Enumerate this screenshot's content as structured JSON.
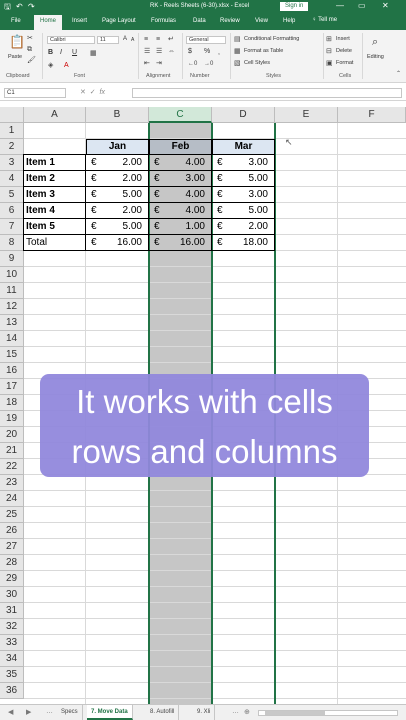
{
  "title_bar": {
    "title": "RK - Reels Sheets (6-30).xlsx  -  Excel",
    "signin": "Sign in",
    "save_glyph": "🖫",
    "undo_glyph": "↶",
    "redo_glyph": "↷",
    "minimize_glyph": "—",
    "restore_glyph": "▭",
    "close_glyph": "✕"
  },
  "ribbon_tabs": [
    "File",
    "Home",
    "Insert",
    "Page Layout",
    "Formulas",
    "Data",
    "Review",
    "View",
    "Help"
  ],
  "active_tab": "Home",
  "tell_me": "Tell me",
  "ribbon": {
    "paste": "Paste",
    "font_name": "Calibri",
    "font_size": "11",
    "bold": "B",
    "italic": "I",
    "underline": "U",
    "number_format": "General",
    "currency_glyph": "$",
    "percent_glyph": "%",
    "conditional_formatting": "Conditional Formatting",
    "format_as_table": "Format as Table",
    "cell_styles": "Cell Styles",
    "insert": "Insert",
    "delete": "Delete",
    "format": "Format",
    "editing": "Editing",
    "groups": [
      "Clipboard",
      "Font",
      "Alignment",
      "Number",
      "Styles",
      "Cells"
    ]
  },
  "formula_bar": {
    "name_box": "C1",
    "cancel_glyph": "✕",
    "enter_glyph": "✓",
    "fx": "fx",
    "content": ""
  },
  "columns": [
    "A",
    "B",
    "C",
    "D",
    "E",
    "F"
  ],
  "selected_column": "C",
  "rows": [
    "1",
    "2",
    "3",
    "4",
    "5",
    "6",
    "7",
    "8",
    "9",
    "10",
    "11",
    "12",
    "13",
    "14",
    "15",
    "16",
    "17",
    "18",
    "19",
    "20",
    "21",
    "22",
    "23",
    "24",
    "25",
    "26",
    "27",
    "28",
    "29",
    "30",
    "31",
    "32",
    "33",
    "34",
    "35",
    "36"
  ],
  "table": {
    "headers": [
      "Jan",
      "Feb",
      "Mar"
    ],
    "currency_symbol": "€",
    "rows": [
      {
        "label": "Item 1",
        "values": [
          "2.00",
          "4.00",
          "3.00"
        ]
      },
      {
        "label": "Item 2",
        "values": [
          "2.00",
          "3.00",
          "5.00"
        ]
      },
      {
        "label": "Item 3",
        "values": [
          "5.00",
          "4.00",
          "3.00"
        ]
      },
      {
        "label": "Item 4",
        "values": [
          "2.00",
          "4.00",
          "5.00"
        ]
      },
      {
        "label": "Item 5",
        "values": [
          "5.00",
          "1.00",
          "2.00"
        ]
      }
    ],
    "total": {
      "label": "Total",
      "values": [
        "16.00",
        "16.00",
        "18.00"
      ]
    }
  },
  "overlay": {
    "line1": "It works with cells",
    "line2": "rows and columns"
  },
  "sheet_tabs": [
    "Specs",
    "7. Move Data",
    "8. Autofill",
    "9. Xli"
  ],
  "active_sheet": "7. Move Data",
  "colors": {
    "excel_green": "#217346",
    "header_fill": "#dce6f2",
    "selected_column_fill": "#c6c6c6",
    "overlay_fill": "#9187dc"
  }
}
